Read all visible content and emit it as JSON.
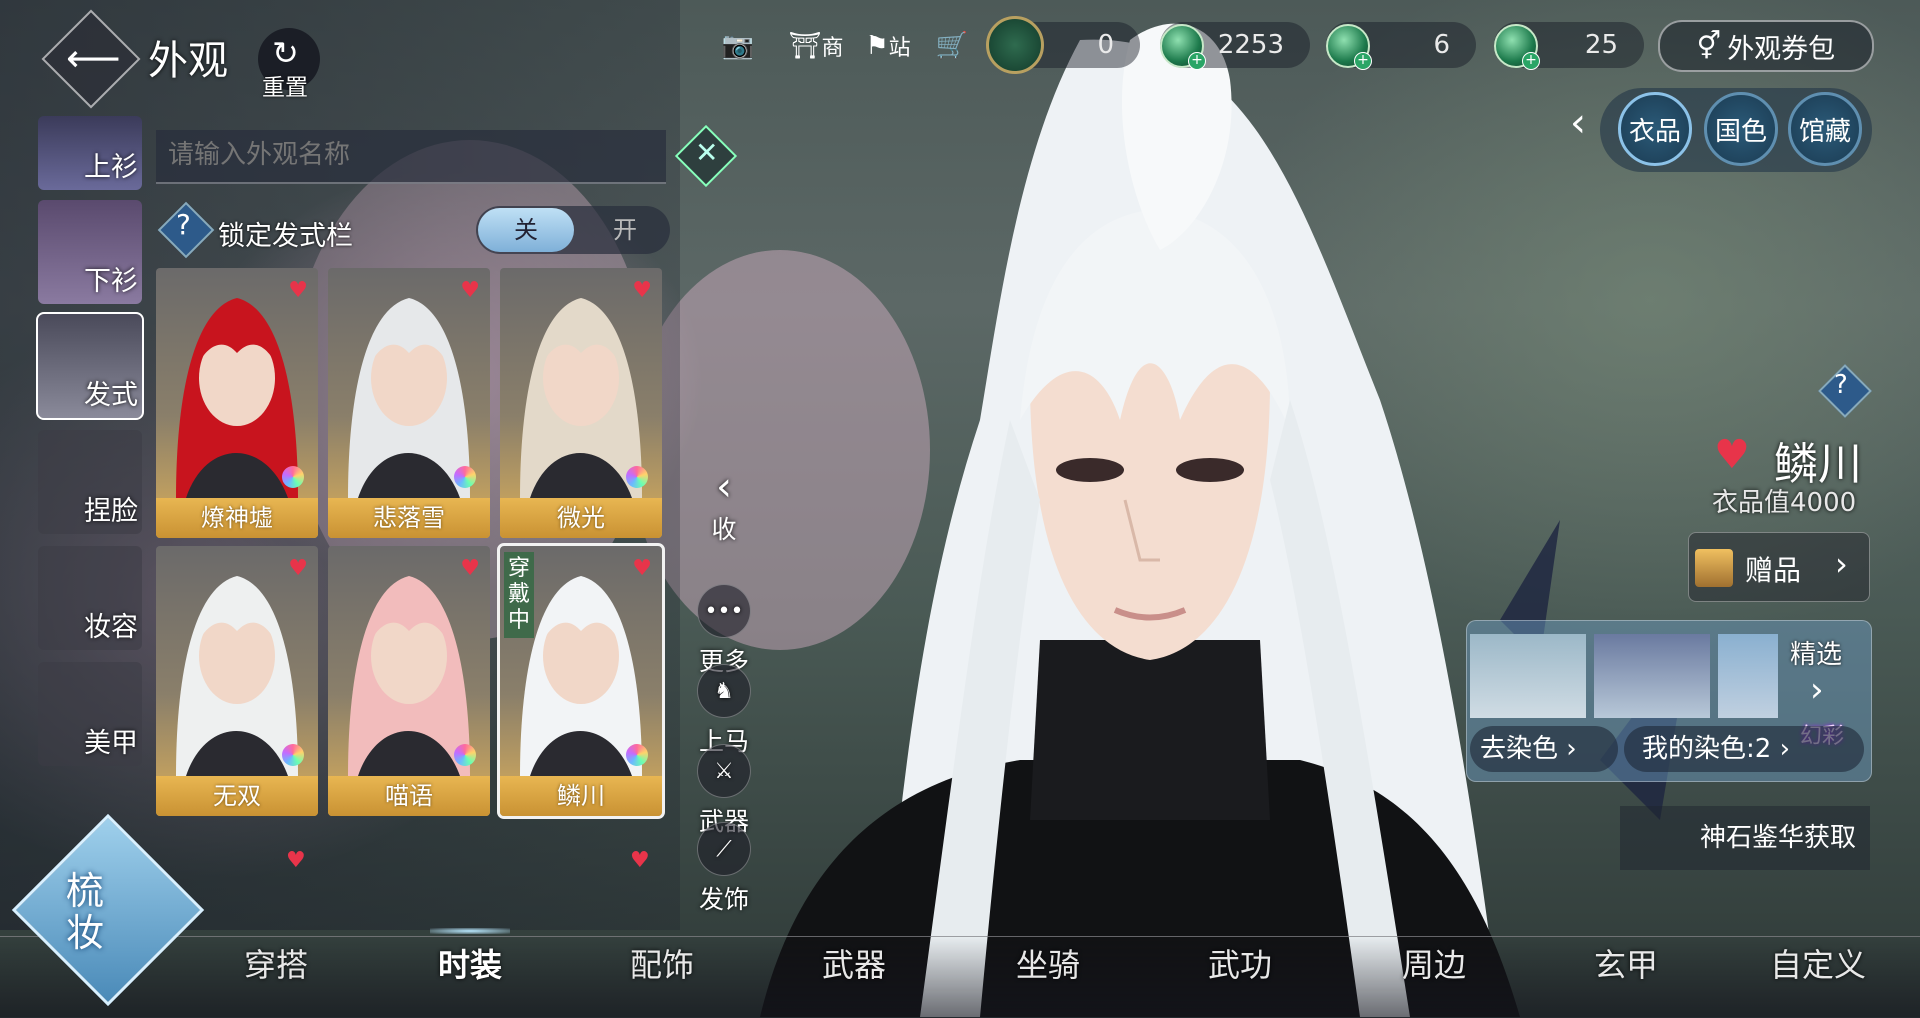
{
  "header": {
    "title": "外观",
    "reset_label": "重置"
  },
  "top_icons": {
    "camera": "camera-icon",
    "shop_label": "商",
    "station_label": "站",
    "cart": "cart-icon"
  },
  "currencies": [
    {
      "value": "0"
    },
    {
      "value": "2253"
    },
    {
      "value": "6"
    },
    {
      "value": "25"
    }
  ],
  "coupon_label": "外观券包",
  "right_tabs": [
    "衣品",
    "国色",
    "馆藏"
  ],
  "search": {
    "placeholder": "请输入外观名称"
  },
  "lock": {
    "label": "锁定发式栏",
    "off": "关",
    "on": "开",
    "state": "关"
  },
  "side_nav": [
    {
      "label": "上衫"
    },
    {
      "label": "下衫"
    },
    {
      "label": "发式"
    },
    {
      "label": "捏脸"
    },
    {
      "label": "妆容"
    },
    {
      "label": "美甲"
    }
  ],
  "hair_cards": [
    {
      "name": "燎神墟",
      "hair_color": "#c8141e"
    },
    {
      "name": "悲落雪",
      "hair_color": "#e6e8ea"
    },
    {
      "name": "微光",
      "hair_color": "#e3d9c9"
    },
    {
      "name": "无双",
      "hair_color": "#eef0f0"
    },
    {
      "name": "喵语",
      "hair_color": "#f2bcbc"
    },
    {
      "name": "鳞川",
      "hair_color": "#f2f4f6",
      "badge": "穿戴中"
    }
  ],
  "vertical_menu": {
    "collapse": "收",
    "more": "更多",
    "mount": "上马",
    "weapon": "武器",
    "hair_accessory": "发饰"
  },
  "item": {
    "name": "鳞川",
    "value_label": "衣品值4000",
    "gift_label": "赠品"
  },
  "dye": {
    "featured": "精选",
    "fantasy": "幻彩",
    "remove": "去染色",
    "mine": "我的染色:2",
    "source": "神石鉴华获取"
  },
  "corner_button": "梳妆",
  "bottom_tabs": [
    "穿搭",
    "时装",
    "配饰",
    "武器",
    "坐骑",
    "武功",
    "周边",
    "玄甲",
    "自定义"
  ],
  "active_bottom_tab": "时装"
}
